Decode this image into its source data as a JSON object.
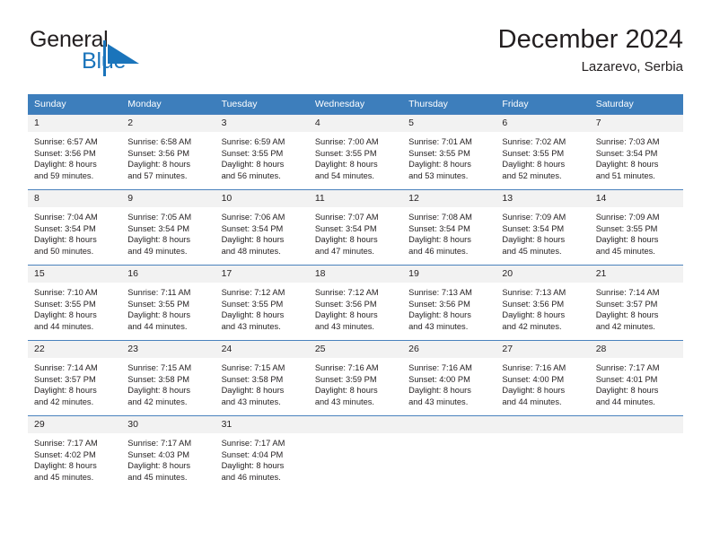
{
  "brand": {
    "word_one": "General",
    "word_two": "Blue",
    "mark": "triangle-logo",
    "accent_color": "#1a74bb"
  },
  "header": {
    "title": "December 2024",
    "subtitle": "Lazarevo, Serbia"
  },
  "calendar": {
    "header_bg": "#3d7ebc",
    "daynum_bg": "#f2f2f2",
    "weekdays": [
      "Sunday",
      "Monday",
      "Tuesday",
      "Wednesday",
      "Thursday",
      "Friday",
      "Saturday"
    ],
    "weeks": [
      [
        {
          "day": "1",
          "sunrise": "Sunrise: 6:57 AM",
          "sunset": "Sunset: 3:56 PM",
          "daylight_1": "Daylight: 8 hours",
          "daylight_2": "and 59 minutes."
        },
        {
          "day": "2",
          "sunrise": "Sunrise: 6:58 AM",
          "sunset": "Sunset: 3:56 PM",
          "daylight_1": "Daylight: 8 hours",
          "daylight_2": "and 57 minutes."
        },
        {
          "day": "3",
          "sunrise": "Sunrise: 6:59 AM",
          "sunset": "Sunset: 3:55 PM",
          "daylight_1": "Daylight: 8 hours",
          "daylight_2": "and 56 minutes."
        },
        {
          "day": "4",
          "sunrise": "Sunrise: 7:00 AM",
          "sunset": "Sunset: 3:55 PM",
          "daylight_1": "Daylight: 8 hours",
          "daylight_2": "and 54 minutes."
        },
        {
          "day": "5",
          "sunrise": "Sunrise: 7:01 AM",
          "sunset": "Sunset: 3:55 PM",
          "daylight_1": "Daylight: 8 hours",
          "daylight_2": "and 53 minutes."
        },
        {
          "day": "6",
          "sunrise": "Sunrise: 7:02 AM",
          "sunset": "Sunset: 3:55 PM",
          "daylight_1": "Daylight: 8 hours",
          "daylight_2": "and 52 minutes."
        },
        {
          "day": "7",
          "sunrise": "Sunrise: 7:03 AM",
          "sunset": "Sunset: 3:54 PM",
          "daylight_1": "Daylight: 8 hours",
          "daylight_2": "and 51 minutes."
        }
      ],
      [
        {
          "day": "8",
          "sunrise": "Sunrise: 7:04 AM",
          "sunset": "Sunset: 3:54 PM",
          "daylight_1": "Daylight: 8 hours",
          "daylight_2": "and 50 minutes."
        },
        {
          "day": "9",
          "sunrise": "Sunrise: 7:05 AM",
          "sunset": "Sunset: 3:54 PM",
          "daylight_1": "Daylight: 8 hours",
          "daylight_2": "and 49 minutes."
        },
        {
          "day": "10",
          "sunrise": "Sunrise: 7:06 AM",
          "sunset": "Sunset: 3:54 PM",
          "daylight_1": "Daylight: 8 hours",
          "daylight_2": "and 48 minutes."
        },
        {
          "day": "11",
          "sunrise": "Sunrise: 7:07 AM",
          "sunset": "Sunset: 3:54 PM",
          "daylight_1": "Daylight: 8 hours",
          "daylight_2": "and 47 minutes."
        },
        {
          "day": "12",
          "sunrise": "Sunrise: 7:08 AM",
          "sunset": "Sunset: 3:54 PM",
          "daylight_1": "Daylight: 8 hours",
          "daylight_2": "and 46 minutes."
        },
        {
          "day": "13",
          "sunrise": "Sunrise: 7:09 AM",
          "sunset": "Sunset: 3:54 PM",
          "daylight_1": "Daylight: 8 hours",
          "daylight_2": "and 45 minutes."
        },
        {
          "day": "14",
          "sunrise": "Sunrise: 7:09 AM",
          "sunset": "Sunset: 3:55 PM",
          "daylight_1": "Daylight: 8 hours",
          "daylight_2": "and 45 minutes."
        }
      ],
      [
        {
          "day": "15",
          "sunrise": "Sunrise: 7:10 AM",
          "sunset": "Sunset: 3:55 PM",
          "daylight_1": "Daylight: 8 hours",
          "daylight_2": "and 44 minutes."
        },
        {
          "day": "16",
          "sunrise": "Sunrise: 7:11 AM",
          "sunset": "Sunset: 3:55 PM",
          "daylight_1": "Daylight: 8 hours",
          "daylight_2": "and 44 minutes."
        },
        {
          "day": "17",
          "sunrise": "Sunrise: 7:12 AM",
          "sunset": "Sunset: 3:55 PM",
          "daylight_1": "Daylight: 8 hours",
          "daylight_2": "and 43 minutes."
        },
        {
          "day": "18",
          "sunrise": "Sunrise: 7:12 AM",
          "sunset": "Sunset: 3:56 PM",
          "daylight_1": "Daylight: 8 hours",
          "daylight_2": "and 43 minutes."
        },
        {
          "day": "19",
          "sunrise": "Sunrise: 7:13 AM",
          "sunset": "Sunset: 3:56 PM",
          "daylight_1": "Daylight: 8 hours",
          "daylight_2": "and 43 minutes."
        },
        {
          "day": "20",
          "sunrise": "Sunrise: 7:13 AM",
          "sunset": "Sunset: 3:56 PM",
          "daylight_1": "Daylight: 8 hours",
          "daylight_2": "and 42 minutes."
        },
        {
          "day": "21",
          "sunrise": "Sunrise: 7:14 AM",
          "sunset": "Sunset: 3:57 PM",
          "daylight_1": "Daylight: 8 hours",
          "daylight_2": "and 42 minutes."
        }
      ],
      [
        {
          "day": "22",
          "sunrise": "Sunrise: 7:14 AM",
          "sunset": "Sunset: 3:57 PM",
          "daylight_1": "Daylight: 8 hours",
          "daylight_2": "and 42 minutes."
        },
        {
          "day": "23",
          "sunrise": "Sunrise: 7:15 AM",
          "sunset": "Sunset: 3:58 PM",
          "daylight_1": "Daylight: 8 hours",
          "daylight_2": "and 42 minutes."
        },
        {
          "day": "24",
          "sunrise": "Sunrise: 7:15 AM",
          "sunset": "Sunset: 3:58 PM",
          "daylight_1": "Daylight: 8 hours",
          "daylight_2": "and 43 minutes."
        },
        {
          "day": "25",
          "sunrise": "Sunrise: 7:16 AM",
          "sunset": "Sunset: 3:59 PM",
          "daylight_1": "Daylight: 8 hours",
          "daylight_2": "and 43 minutes."
        },
        {
          "day": "26",
          "sunrise": "Sunrise: 7:16 AM",
          "sunset": "Sunset: 4:00 PM",
          "daylight_1": "Daylight: 8 hours",
          "daylight_2": "and 43 minutes."
        },
        {
          "day": "27",
          "sunrise": "Sunrise: 7:16 AM",
          "sunset": "Sunset: 4:00 PM",
          "daylight_1": "Daylight: 8 hours",
          "daylight_2": "and 44 minutes."
        },
        {
          "day": "28",
          "sunrise": "Sunrise: 7:17 AM",
          "sunset": "Sunset: 4:01 PM",
          "daylight_1": "Daylight: 8 hours",
          "daylight_2": "and 44 minutes."
        }
      ],
      [
        {
          "day": "29",
          "sunrise": "Sunrise: 7:17 AM",
          "sunset": "Sunset: 4:02 PM",
          "daylight_1": "Daylight: 8 hours",
          "daylight_2": "and 45 minutes."
        },
        {
          "day": "30",
          "sunrise": "Sunrise: 7:17 AM",
          "sunset": "Sunset: 4:03 PM",
          "daylight_1": "Daylight: 8 hours",
          "daylight_2": "and 45 minutes."
        },
        {
          "day": "31",
          "sunrise": "Sunrise: 7:17 AM",
          "sunset": "Sunset: 4:04 PM",
          "daylight_1": "Daylight: 8 hours",
          "daylight_2": "and 46 minutes."
        },
        {
          "day": "",
          "sunrise": "",
          "sunset": "",
          "daylight_1": "",
          "daylight_2": ""
        },
        {
          "day": "",
          "sunrise": "",
          "sunset": "",
          "daylight_1": "",
          "daylight_2": ""
        },
        {
          "day": "",
          "sunrise": "",
          "sunset": "",
          "daylight_1": "",
          "daylight_2": ""
        },
        {
          "day": "",
          "sunrise": "",
          "sunset": "",
          "daylight_1": "",
          "daylight_2": ""
        }
      ]
    ]
  }
}
